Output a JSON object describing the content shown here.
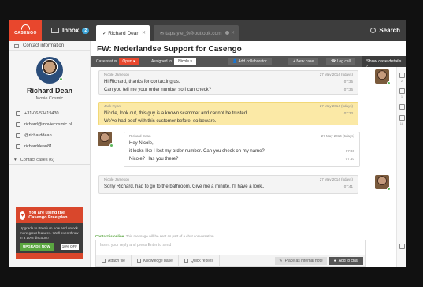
{
  "app": {
    "logo": "CASENGO"
  },
  "topbar": {
    "inbox_label": "Inbox",
    "inbox_count": "2",
    "tabs": [
      {
        "label": "Richard Dean",
        "active": true
      },
      {
        "label": "tapstyle_9@outlook.com",
        "active": false
      }
    ],
    "search_label": "Search"
  },
  "sidebar": {
    "header": "Contact information",
    "name": "Richard Dean",
    "company": "Movie Cosmic",
    "contacts": [
      "+31-06-53419430",
      "richard@moviecosmic.nl",
      "@richarddean",
      "richarddean81"
    ],
    "cases_label": "Contact cases (6)",
    "promo": {
      "title": "You are using the Casengo Free plan",
      "body": "Upgrade to Premium now and unlock more great features. We'll even throw in a 10% discount!",
      "button": "UPGRADE NOW",
      "discount": "10% OFF"
    }
  },
  "case": {
    "title": "FW: Nederlandse Support for Casengo",
    "status_label": "Case status",
    "status_value": "Open",
    "assigned_label": "Assigned to",
    "assigned_value": "Nicole",
    "add_collaborator": "Add collaborator",
    "new_case": "New case",
    "log_call": "Log call",
    "show_details": "Show case details"
  },
  "messages": [
    {
      "author": "Nicole Jameson",
      "date": "27 May 2014 (5days)",
      "lines": [
        {
          "text": "Hi Richard, thanks for contacting us.",
          "time": "07:35"
        },
        {
          "text": "Can you tell me your order number so I can check?",
          "time": "07:36"
        }
      ]
    },
    {
      "author": "Jack Ryan",
      "date": "27 May 2014 (5days)",
      "lines": [
        {
          "text": "Nicole, look out, this guy is a known scammer and cannot be trusted.",
          "time": "07:33"
        },
        {
          "text": "We've had beef with this customer before, so beware.",
          "time": ""
        }
      ]
    },
    {
      "author": "Richard Dean",
      "date": "27 May 2014 (5days)",
      "lines": [
        {
          "text": "Hey Nicole,",
          "time": ""
        },
        {
          "text": "it looks like I lost my order number. Can you check on my name?",
          "time": "07:36"
        },
        {
          "text": "Nicole? Has you there?",
          "time": "07:40"
        }
      ]
    },
    {
      "author": "Nicole Jameson",
      "date": "27 May 2014 (5days)",
      "lines": [
        {
          "text": "Sorry Richard, had to go to the bathroom. Give me a minute, I'll have a look...",
          "time": "07:41"
        }
      ]
    }
  ],
  "composer": {
    "status_prefix": "Contact is online.",
    "status_text": "This message will be sent as part of a chat conversation.",
    "placeholder": "Insert your reply and press Enter to send",
    "attach": "Attach file",
    "knowledge": "Knowledge base",
    "quick": "Quick replies",
    "internal": "Place as internal note",
    "add_chat": "Add to chat"
  },
  "rightstrip": {
    "counts": [
      "2",
      "1",
      "",
      "18"
    ]
  }
}
